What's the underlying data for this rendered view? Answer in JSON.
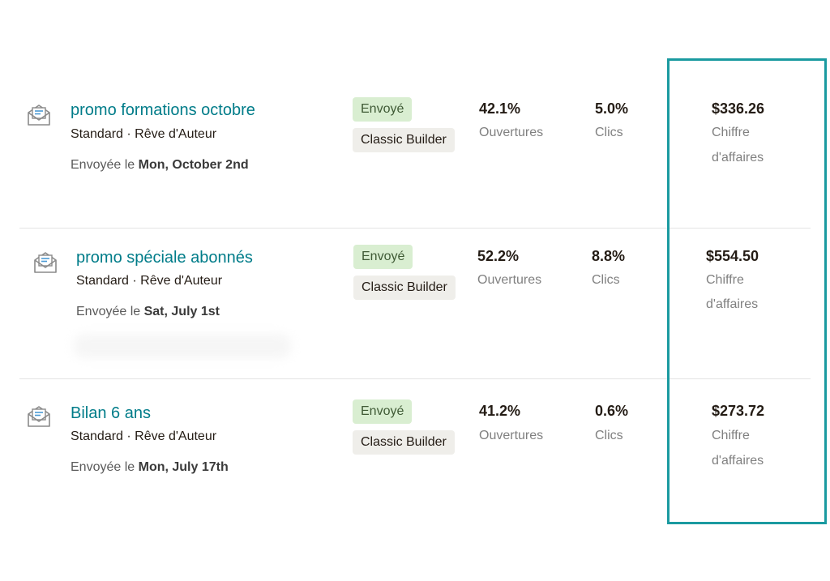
{
  "campaigns": [
    {
      "title": "promo formations octobre",
      "meta": "Standard · Rêve d'Auteur",
      "sent_prefix": "Envoyée le ",
      "sent_date": "Mon, October 2nd",
      "status": "Envoyé",
      "builder": "Classic Builder",
      "opens_value": "42.1%",
      "opens_label": "Ouvertures",
      "clicks_value": "5.0%",
      "clicks_label": "Clics",
      "revenue_value": "$336.26",
      "revenue_label_1": "Chiffre",
      "revenue_label_2": "d'affaires"
    },
    {
      "title": "promo spéciale abonnés",
      "meta": "Standard · Rêve d'Auteur",
      "sent_prefix": "Envoyée le ",
      "sent_date": "Sat, July 1st",
      "status": "Envoyé",
      "builder": "Classic Builder",
      "opens_value": "52.2%",
      "opens_label": "Ouvertures",
      "clicks_value": "8.8%",
      "clicks_label": "Clics",
      "revenue_value": "$554.50",
      "revenue_label_1": "Chiffre",
      "revenue_label_2": "d'affaires"
    },
    {
      "title": "Bilan 6 ans",
      "meta": "Standard · Rêve d'Auteur",
      "sent_prefix": "Envoyée le ",
      "sent_date": "Mon, July 17th",
      "status": "Envoyé",
      "builder": "Classic Builder",
      "opens_value": "41.2%",
      "opens_label": "Ouvertures",
      "clicks_value": "0.6%",
      "clicks_label": "Clics",
      "revenue_value": "$273.72",
      "revenue_label_1": "Chiffre",
      "revenue_label_2": "d'affaires"
    }
  ],
  "icons": {
    "campaign_icon": "email-campaign-icon"
  },
  "colors": {
    "title_link": "#007c89",
    "status_badge_bg": "#d9eed1",
    "builder_badge_bg": "#efeeea",
    "highlight_border": "#1a9aa0"
  }
}
